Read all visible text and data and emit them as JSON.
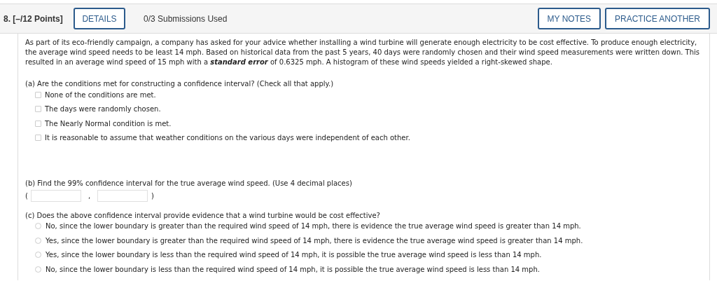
{
  "header": {
    "question_number": "8.",
    "points": "[–/12 Points]",
    "details_button": "DETAILS",
    "submissions": "0/3 Submissions Used",
    "buttons": [
      "MY NOTES",
      "PRACTICE ANOTHER"
    ]
  },
  "intro": "As part of its eco-friendly campaign, a company has asked for your advice whether installing a wind turbine will generate enough electricity to be cost effective. To produce enough electricity, the average wind speed needs to be least 14 mph. Based on historical data from the past 5 years, 40 days were randomly chosen and their wind speed measurements were written down. This resulted in an average wind speed of 15 mph with a **standard error** of 0.6325 mph. A histogram of these wind speeds yielded a right-skewed shape.",
  "part_a": {
    "prompt": "(a) Are the conditions met for constructing a confidence interval? (Check all that apply.)",
    "options": [
      {
        "label": "None of the conditions are met.",
        "checked": false
      },
      {
        "label": "The days were randomly chosen.",
        "checked": false
      },
      {
        "label": "The Nearly Normal condition is met.",
        "checked": false
      },
      {
        "label": "It is reasonable to assume that weather conditions on the various days were independent of each other.",
        "checked": false
      }
    ]
  },
  "part_b": {
    "prompt": "(b) Find the 99% confidence interval for the true average wind speed. (Use 4 decimal places)",
    "open": "(",
    "separator": ",",
    "close": ")"
  },
  "part_c": {
    "prompt": "(c) Does the above confidence interval provide evidence that a wind turbine would be cost effective?",
    "options": [
      {
        "label": "No, since the lower boundary is greater than the required wind speed of 14 mph, there is evidence the true average wind speed is greater than 14 mph.",
        "selected": false
      },
      {
        "label": "Yes, since the lower boundary is greater than the required wind speed of 14 mph, there is evidence the true average wind speed is greater than 14 mph.",
        "selected": false
      },
      {
        "label": "Yes, since the lower boundary is less than the required wind speed of 14 mph, it is possible the true average wind speed is less than 14 mph.",
        "selected": false
      },
      {
        "label": "No, since the lower boundary is less than the required wind speed of 14 mph, it is possible the true average wind speed is less than 14 mph.",
        "selected": false
      }
    ]
  }
}
